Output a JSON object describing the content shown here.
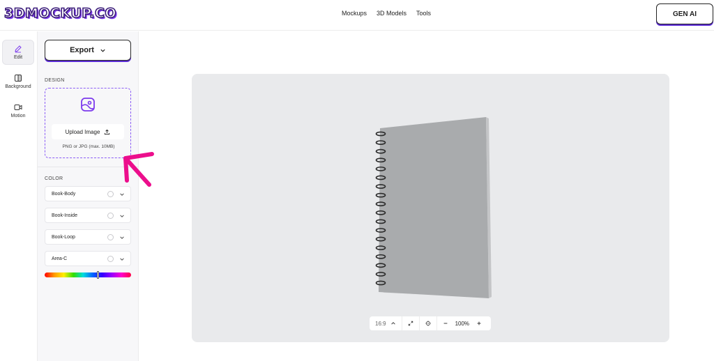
{
  "header": {
    "logo": "3DMOCKUP.CO",
    "nav": [
      "Mockups",
      "3D Models",
      "Tools"
    ],
    "gen_ai": "GEN AI"
  },
  "rail": {
    "items": [
      {
        "label": "Edit",
        "icon": "pencil-icon",
        "active": true
      },
      {
        "label": "Background",
        "icon": "background-icon",
        "active": false
      },
      {
        "label": "Motion",
        "icon": "video-icon",
        "active": false
      }
    ]
  },
  "panel": {
    "export_label": "Export",
    "design_label": "DESIGN",
    "upload_label": "Upload Image",
    "upload_hint": "PNG or JPG (max. 10MB)",
    "color_label": "COLOR",
    "color_rows": [
      {
        "name": "Book-Body"
      },
      {
        "name": "Book-Inside"
      },
      {
        "name": "Book-Loop"
      },
      {
        "name": "Area-C"
      }
    ],
    "hue_position": 0.62
  },
  "canvas": {
    "aspect_ratio": "16:9",
    "zoom": "100%"
  },
  "colors": {
    "accent": "#7c3aed",
    "annotation_arrow": "#ec0e8c",
    "notebook_cover": "#a9abad"
  }
}
